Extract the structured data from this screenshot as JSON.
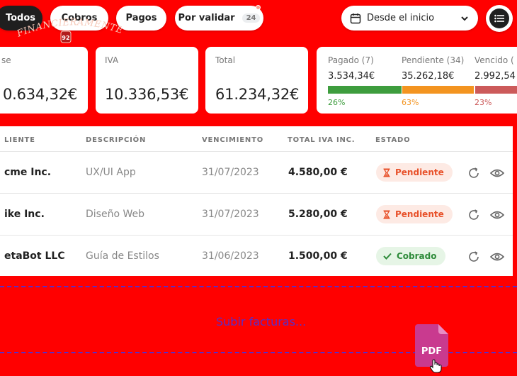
{
  "filters": {
    "todos": "Todos",
    "cobros": "Cobros",
    "pagos": "Pagos",
    "por_validar": "Por validar",
    "por_validar_count": "24"
  },
  "date_filter": {
    "label": "Desde el inicio",
    "icon": "calendar-icon"
  },
  "logo": {
    "text": "FINANCIERAMENTE",
    "mark": "92"
  },
  "summary": {
    "base": {
      "label": "se",
      "value": "0.634,32€"
    },
    "iva": {
      "label": "IVA",
      "value": "10.336,53€"
    },
    "total": {
      "label": "Total",
      "value": "61.234,32€"
    },
    "status": [
      {
        "label": "Pagado (7)",
        "amount": "3.534,34€",
        "percent": "26%",
        "fraction": 0.26,
        "color": "#3e9d3e"
      },
      {
        "label": "Pendiente (34)",
        "amount": "35.262,18€",
        "percent": "63%",
        "fraction": 0.63,
        "color": "#f39420"
      },
      {
        "label": "Vencido (",
        "amount": "2.992,54",
        "percent": "23%",
        "fraction": 0.23,
        "color": "#cc5a5a"
      }
    ]
  },
  "table": {
    "headers": {
      "client": "LIENTE",
      "description": "DESCRIPCIÓN",
      "due": "VENCIMIENTO",
      "total": "TOTAL IVA INC.",
      "status": "ESTADO"
    },
    "rows": [
      {
        "client": "cme Inc.",
        "description": "UX/UI App",
        "due": "31/07/2023",
        "total": "4.580,00 €",
        "status": "Pendiente",
        "status_kind": "pending"
      },
      {
        "client": "ike Inc.",
        "description": "Diseño Web",
        "due": "31/07/2023",
        "total": "5.280,00 €",
        "status": "Pendiente",
        "status_kind": "pending"
      },
      {
        "client": "etaBot LLC",
        "description": "Guía de Estilos",
        "due": "31/06/2023",
        "total": "1.500,00 €",
        "status": "Cobrado",
        "status_kind": "paid"
      }
    ]
  },
  "upload": {
    "text": "Subir facturas...",
    "file_label": "PDF"
  },
  "colors": {
    "background": "#ff0000",
    "pending_bg": "#fdeae4",
    "pending_fg": "#e8512a",
    "paid_bg": "#e6f5e6",
    "paid_fg": "#2e8b3a",
    "upload_accent": "#5a2dc6",
    "pdf": "#c93a8f"
  }
}
